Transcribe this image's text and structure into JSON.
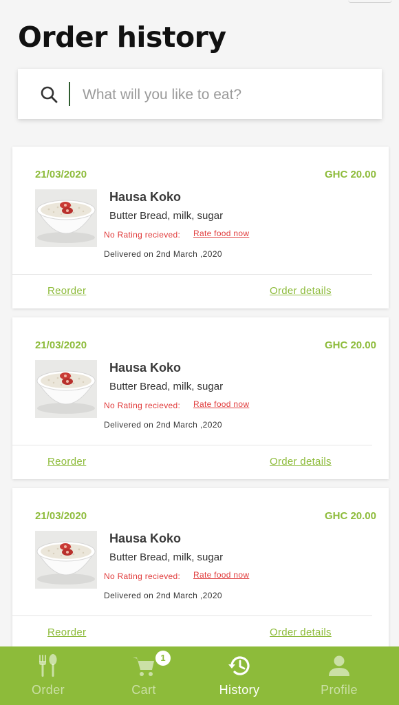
{
  "page": {
    "title": "Order history"
  },
  "search": {
    "placeholder": "What will you like to eat?",
    "value": ""
  },
  "orders": [
    {
      "date": "21/03/2020",
      "price": "GHC 20.00",
      "food_name": "Hausa Koko",
      "description": "Butter Bread, milk, sugar",
      "rating_status": "No Rating recieved:",
      "rate_link": "Rate food now",
      "delivery": "Delivered on 2nd March ,2020",
      "reorder_label": "Reorder",
      "details_label": "Order details"
    },
    {
      "date": "21/03/2020",
      "price": "GHC 20.00",
      "food_name": "Hausa Koko",
      "description": "Butter Bread, milk, sugar",
      "rating_status": "No Rating recieved:",
      "rate_link": "Rate food now",
      "delivery": "Delivered on 2nd March ,2020",
      "reorder_label": "Reorder",
      "details_label": "Order details"
    },
    {
      "date": "21/03/2020",
      "price": "GHC 20.00",
      "food_name": "Hausa Koko",
      "description": "Butter Bread, milk, sugar",
      "rating_status": "No Rating recieved:",
      "rate_link": "Rate food now",
      "delivery": "Delivered on 2nd March ,2020",
      "reorder_label": "Reorder",
      "details_label": "Order details"
    }
  ],
  "bottom_nav": {
    "items": [
      {
        "label": "Order",
        "icon": "fork-spoon-icon",
        "active": false
      },
      {
        "label": "Cart",
        "icon": "cart-icon",
        "active": false,
        "badge": "1"
      },
      {
        "label": "History",
        "icon": "history-icon",
        "active": true
      },
      {
        "label": "Profile",
        "icon": "person-icon",
        "active": false
      }
    ]
  },
  "colors": {
    "accent": "#8dbb3a",
    "alert": "#e03a3a",
    "text_dark": "#111111",
    "background": "#f5f5f5"
  }
}
